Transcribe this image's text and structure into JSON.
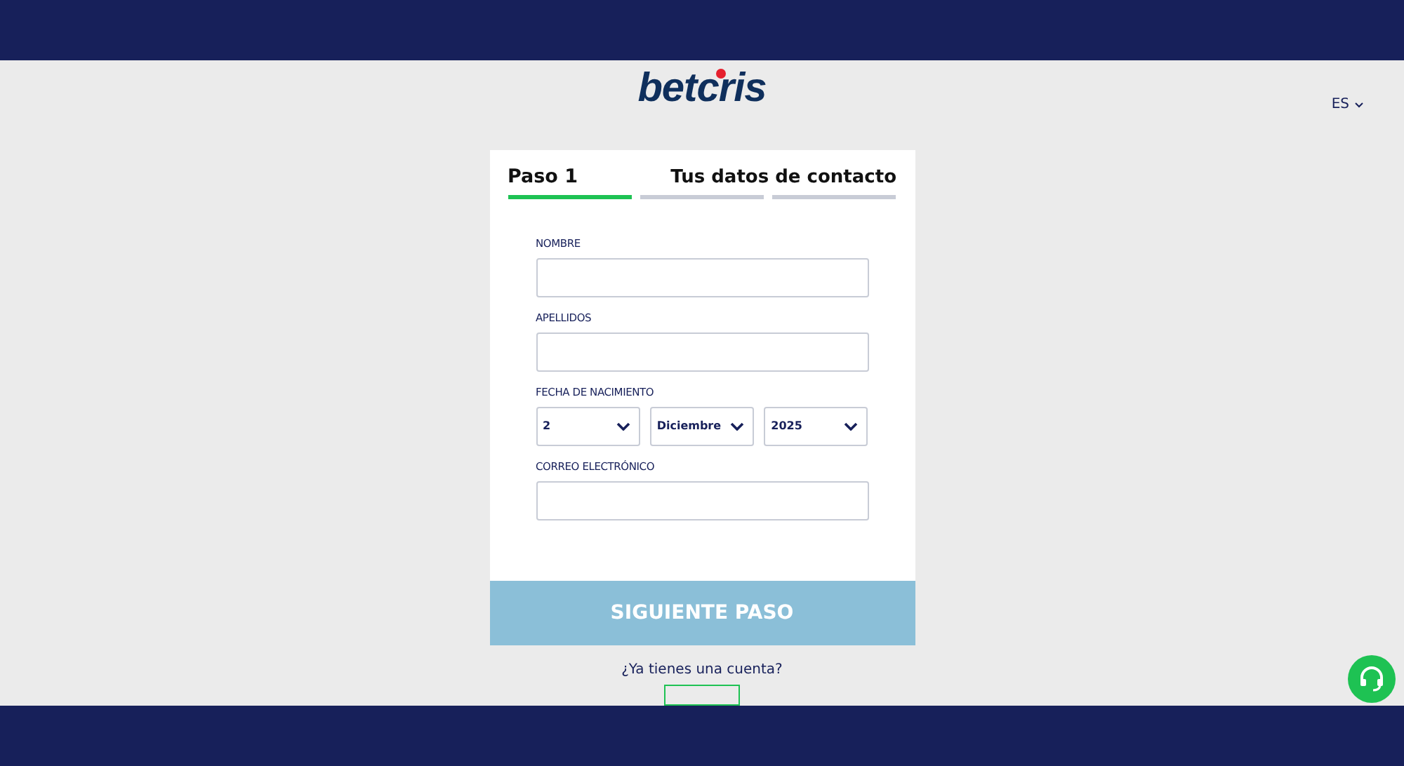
{
  "header": {
    "logo": "betcris",
    "language": "ES"
  },
  "steps": {
    "current": "Paso 1",
    "title": "Tus datos de contacto",
    "progress": [
      {
        "active": true
      },
      {
        "active": false
      },
      {
        "active": false
      }
    ]
  },
  "fields": [
    {
      "kind": "text",
      "label": "NOMBRE"
    },
    {
      "kind": "text",
      "label": "APELLIDOS"
    },
    {
      "kind": "date",
      "label": "FECHA DE NACIMIENTO",
      "selects": [
        "2",
        "Diciembre",
        "2025"
      ]
    },
    {
      "kind": "text",
      "label": "CORREO ELECTRÓNICO"
    }
  ],
  "submit": "SIGUIENTE PASO",
  "account_prompt": "¿Ya tienes una cuenta?"
}
